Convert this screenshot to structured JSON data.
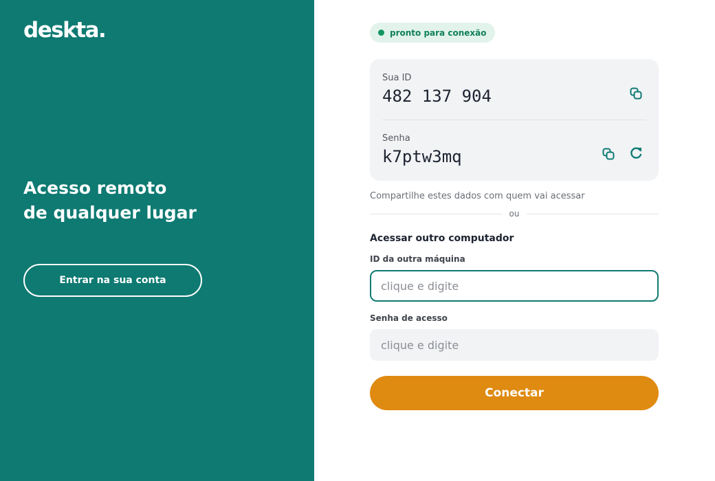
{
  "brand": {
    "logo": "deskta."
  },
  "hero": {
    "line1": "Acesso remoto",
    "line2": "de qualquer lugar"
  },
  "login": {
    "label": "Entrar na sua conta"
  },
  "status": {
    "text": "pronto para conexão",
    "color": "#12965f"
  },
  "credentials": {
    "id_label": "Sua ID",
    "id_value": "482 137 904",
    "password_label": "Senha",
    "password_value": "k7ptw3mq"
  },
  "share_hint": "Compartilhe estes dados com quem vai acessar",
  "divider_text": "ou",
  "remote": {
    "title": "Acessar outro computador",
    "id_label": "ID da outra máquina",
    "id_placeholder": "clique e digite",
    "password_label": "Senha de acesso",
    "password_placeholder": "clique e digite",
    "connect_label": "Conectar"
  },
  "colors": {
    "primary": "#0e7a72",
    "accent": "#df8a10"
  },
  "icons": [
    "copy-icon",
    "refresh-icon"
  ]
}
